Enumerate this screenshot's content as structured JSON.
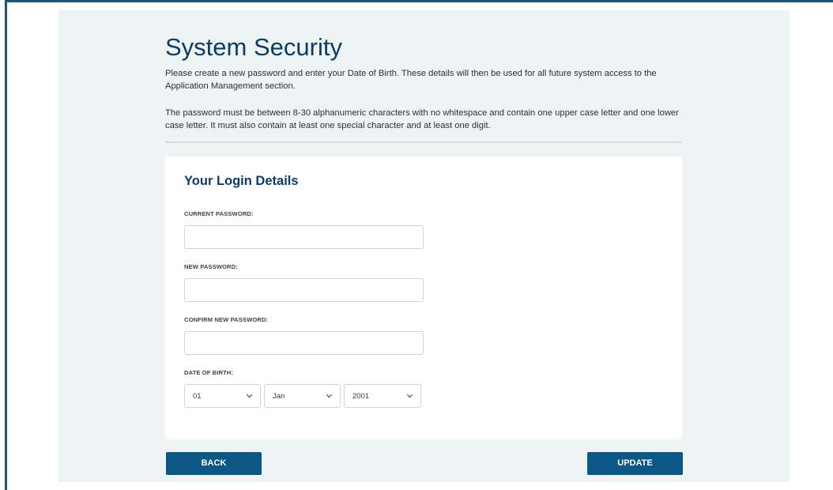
{
  "page": {
    "title": "System Security",
    "intro_1": "Please create a new password and enter your Date of Birth. These details will then be used for all future system access to the Application Management section.",
    "intro_2": "The password must be between 8-30 alphanumeric characters with no whitespace and contain one upper case letter and one lower case letter. It must also contain at least one special character and at least one digit."
  },
  "form": {
    "title": "Your Login Details",
    "current_password": {
      "label": "CURRENT PASSWORD:",
      "value": ""
    },
    "new_password": {
      "label": "NEW PASSWORD:",
      "value": ""
    },
    "confirm_password": {
      "label": "CONFIRM NEW PASSWORD:",
      "value": ""
    },
    "dob": {
      "label": "DATE OF BIRTH:",
      "day": "01",
      "month": "Jan",
      "year": "2001"
    }
  },
  "actions": {
    "back_label": "BACK",
    "update_label": "UPDATE"
  },
  "colors": {
    "accent": "#0c5785",
    "heading": "#0d3c66",
    "frame": "#1f5570",
    "panel_bg": "#eef3f4"
  },
  "icons": {
    "select_chevron": "chevron-down-icon"
  }
}
